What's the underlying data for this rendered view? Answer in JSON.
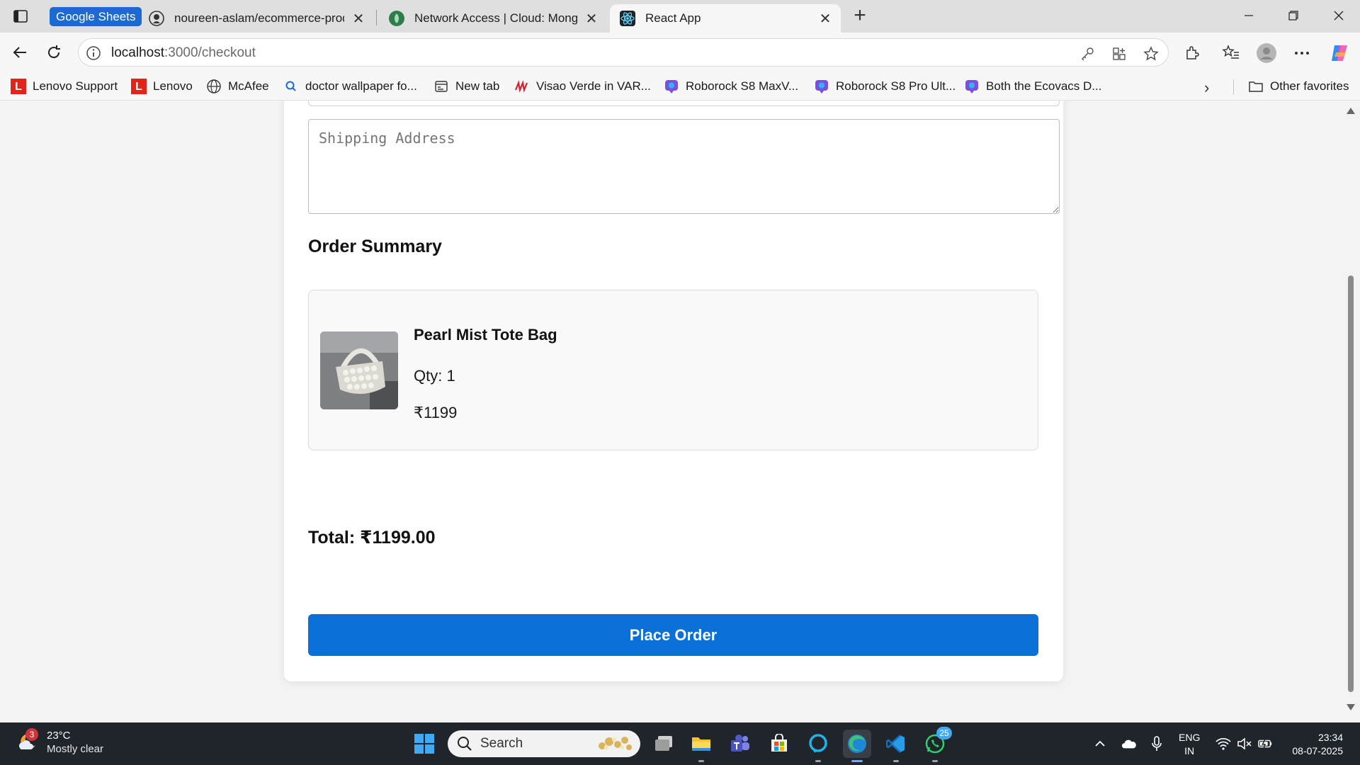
{
  "browser": {
    "tab_group_label": "Google Sheets",
    "tabs": [
      {
        "title": "noureen-aslam/ecommerce-prod",
        "icon": "github-icon",
        "active": false
      },
      {
        "title": "Network Access | Cloud: MongoD",
        "icon": "mongodb-leaf-icon",
        "active": false
      },
      {
        "title": "React App",
        "icon": "react-icon",
        "active": true
      }
    ],
    "url_host": "localhost",
    "url_path": ":3000/checkout",
    "bookmarks": [
      {
        "label": "Lenovo Support",
        "icon": "lenovo-icon"
      },
      {
        "label": "Lenovo",
        "icon": "lenovo-icon"
      },
      {
        "label": "McAfee",
        "icon": "globe-icon"
      },
      {
        "label": "doctor wallpaper fo...",
        "icon": "search-icon"
      },
      {
        "label": "New tab",
        "icon": "newtab-icon"
      },
      {
        "label": "Visao Verde in VAR...",
        "icon": "varanasi-icon"
      },
      {
        "label": "Roborock S8 MaxV...",
        "icon": "copilot-page-icon"
      },
      {
        "label": "Roborock S8 Pro Ult...",
        "icon": "copilot-page-icon"
      },
      {
        "label": "Both the Ecovacs D...",
        "icon": "copilot-page-icon"
      }
    ],
    "other_favorites": "Other favorites"
  },
  "checkout": {
    "address_placeholder": "Shipping Address",
    "order_summary_title": "Order Summary",
    "item": {
      "name": "Pearl Mist Tote Bag",
      "qty_label": "Qty: 1",
      "price": "₹1199"
    },
    "total_label": "Total: ₹1199.00",
    "place_order_label": "Place Order"
  },
  "taskbar": {
    "weather_temp": "23°C",
    "weather_condition": "Mostly clear",
    "weather_badge": "3",
    "search_placeholder": "Search",
    "whatsapp_badge": "25",
    "lang_line1": "ENG",
    "lang_line2": "IN",
    "time": "23:34",
    "date": "08-07-2025"
  },
  "colors": {
    "accent": "#0a6fd6",
    "tab_group": "#1b6ad2",
    "taskbar": "#20242b"
  }
}
